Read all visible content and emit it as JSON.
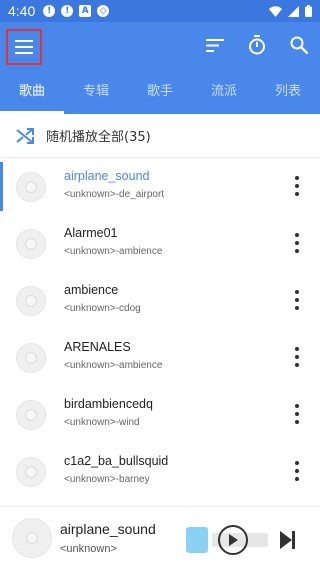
{
  "statusbar": {
    "time": "4:40"
  },
  "tabs": [
    {
      "label": "歌曲"
    },
    {
      "label": "专辑"
    },
    {
      "label": "歌手"
    },
    {
      "label": "流派"
    },
    {
      "label": "列表"
    }
  ],
  "shuffle": {
    "label": "随机播放全部(35)"
  },
  "songs": [
    {
      "title": "airplane_sound",
      "subtitle": "<unknown>-de_airport"
    },
    {
      "title": "Alarme01",
      "subtitle": "<unknown>-ambience"
    },
    {
      "title": "ambience",
      "subtitle": "<unknown>-cdog"
    },
    {
      "title": "ARENALES",
      "subtitle": "<unknown>-ambience"
    },
    {
      "title": "birdambiencedq",
      "subtitle": "<unknown>-wind"
    },
    {
      "title": "c1a2_ba_bullsquid",
      "subtitle": "<unknown>-barney"
    }
  ],
  "player": {
    "title": "airplane_sound",
    "subtitle": "<unknown>"
  },
  "colors": {
    "primary": "#4a87ea",
    "statusbar": "#3a78e0",
    "highlight_box": "#e03535"
  }
}
